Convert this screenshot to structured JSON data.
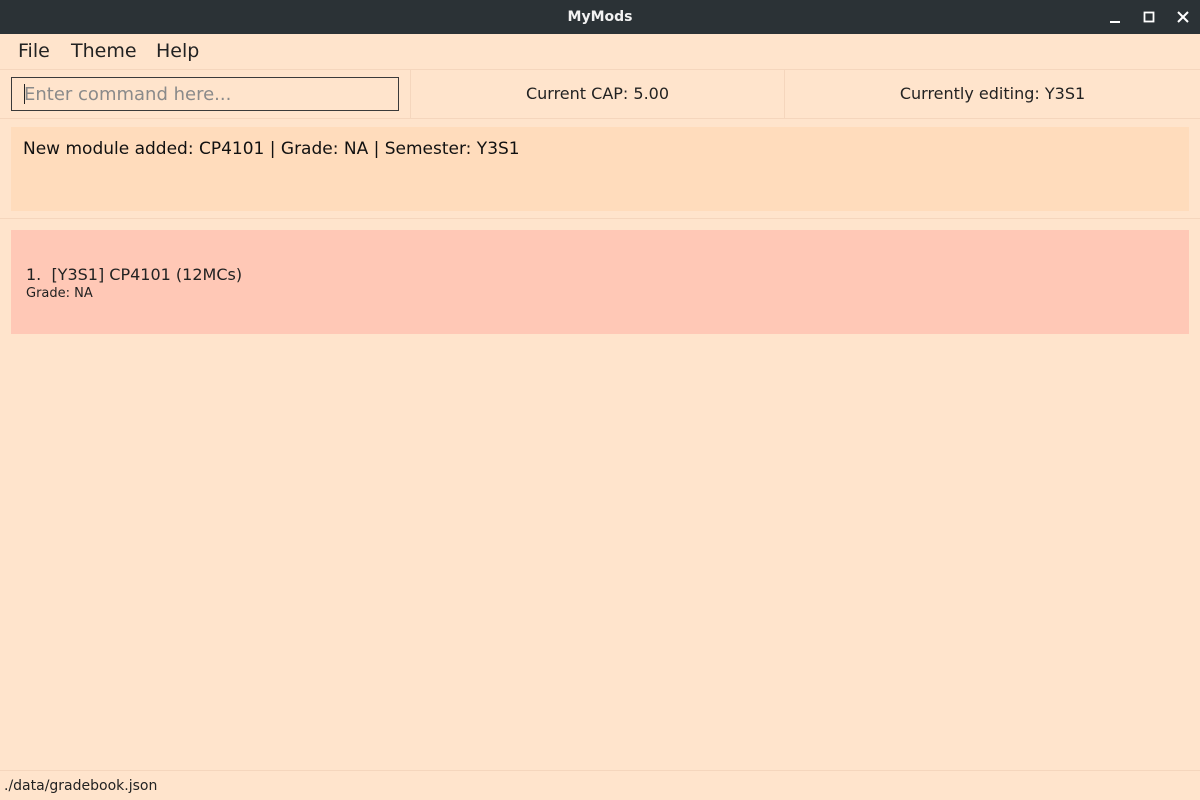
{
  "window": {
    "title": "MyMods"
  },
  "menu": {
    "file": "File",
    "theme": "Theme",
    "help": "Help"
  },
  "command": {
    "placeholder": "Enter command here...",
    "value": ""
  },
  "status": {
    "cap": "Current CAP: 5.00",
    "editing": "Currently editing: Y3S1"
  },
  "result": {
    "message": "New module added: CP4101 | Grade: NA | Semester: Y3S1"
  },
  "modules": [
    {
      "title": "1.  [Y3S1] CP4101 (12MCs)",
      "grade": "Grade: NA"
    }
  ],
  "footer": {
    "path": "./data/gradebook.json"
  },
  "icons": {
    "minimize": "minimize-icon",
    "maximize": "maximize-icon",
    "close": "close-icon"
  },
  "colors": {
    "background": "#ffe4cc",
    "result_box": "#ffdcbc",
    "module_card": "#ffc8b6",
    "titlebar": "#2b3236"
  }
}
